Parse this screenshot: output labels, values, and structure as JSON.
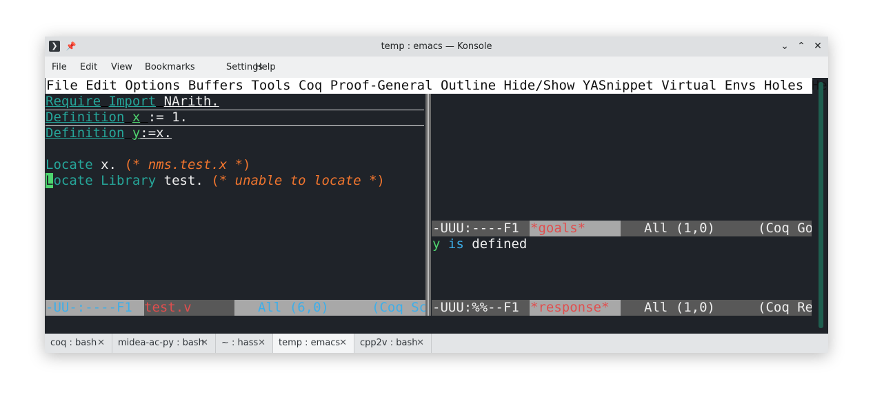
{
  "window": {
    "title": "temp : emacs — Konsole"
  },
  "menubar": [
    "File",
    "Edit",
    "View",
    "Bookmarks",
    "Settings",
    "Help"
  ],
  "emacs_menu": "File Edit Options Buffers Tools Coq Proof-General Outline Hide/Show YASnippet Virtual Envs Holes Help",
  "buffer": {
    "l1": {
      "kw1": "Require",
      "kw2": "Import",
      "rest": "NArith."
    },
    "l2": {
      "kw": "Definition",
      "var": "x",
      "rest": ":= 1."
    },
    "l3": {
      "kw": "Definition",
      "var": "y",
      "rest": ":=x."
    },
    "l5": {
      "kw": "Locate",
      "rest": "x.",
      "c_open": "(*",
      "c_body": "nms.test.x",
      "c_close": "*)"
    },
    "l6": {
      "cursor_char": "L",
      "kw": "ocate Library",
      "rest": "test.",
      "c_open": "(*",
      "c_body": "unable to locate",
      "c_close": "*)"
    }
  },
  "modeline_left": {
    "state": "-UU-:----F1",
    "bufname": "test.v",
    "pos": "All (6,0)",
    "mode": "(Coq Sc"
  },
  "modeline_goals": {
    "state": "-UUU:----F1",
    "bufname": "*goals*",
    "pos": "All (1,0)",
    "mode": "(Coq Go"
  },
  "response_text": {
    "var": "y",
    "kw": "is",
    "rest": "defined"
  },
  "modeline_response": {
    "state": "-UUU:%%--F1",
    "bufname": "*response*",
    "pos": "All (1,0)",
    "mode": "(Coq Re"
  },
  "tabs": [
    {
      "label": "coq : bash",
      "close": "✕"
    },
    {
      "label": "midea-ac-py : bash",
      "close": "✕"
    },
    {
      "label": "~ : hass",
      "close": "✕"
    },
    {
      "label": "temp : emacs",
      "close": "✕"
    },
    {
      "label": "cpp2v : bash",
      "close": "✕"
    }
  ],
  "colors": {
    "keyword": "#26a69a",
    "variable": "#4ed46e",
    "comment": "#f0752e",
    "modeline_text": "#3daee9",
    "bufname": "#e04e4e"
  }
}
